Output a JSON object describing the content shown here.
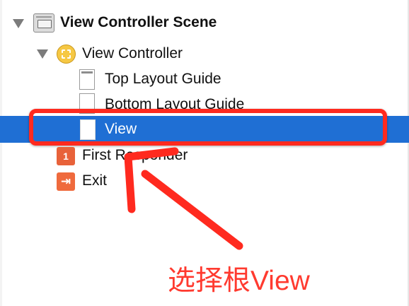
{
  "outline": {
    "scene": {
      "label": "View Controller Scene",
      "icon": "storyboard-scene-icon",
      "expanded": true
    },
    "controller": {
      "label": "View Controller",
      "icon": "view-controller-icon",
      "expanded": true
    },
    "children": [
      {
        "label": "Top Layout Guide",
        "icon": "layout-guide-icon"
      },
      {
        "label": "Bottom Layout Guide",
        "icon": "layout-guide-icon"
      },
      {
        "label": "View",
        "icon": "view-icon",
        "selected": true
      }
    ],
    "first_responder": {
      "label": "First Responder",
      "icon": "first-responder-icon",
      "badge": "1"
    },
    "exit": {
      "label": "Exit",
      "icon": "exit-icon",
      "glyph": "⇥"
    }
  },
  "annotation": {
    "caption": "选择根View",
    "color": "#ff3a2f"
  },
  "colors": {
    "selection": "#1f6fd4",
    "highlight_outline": "#ff2a1f"
  }
}
